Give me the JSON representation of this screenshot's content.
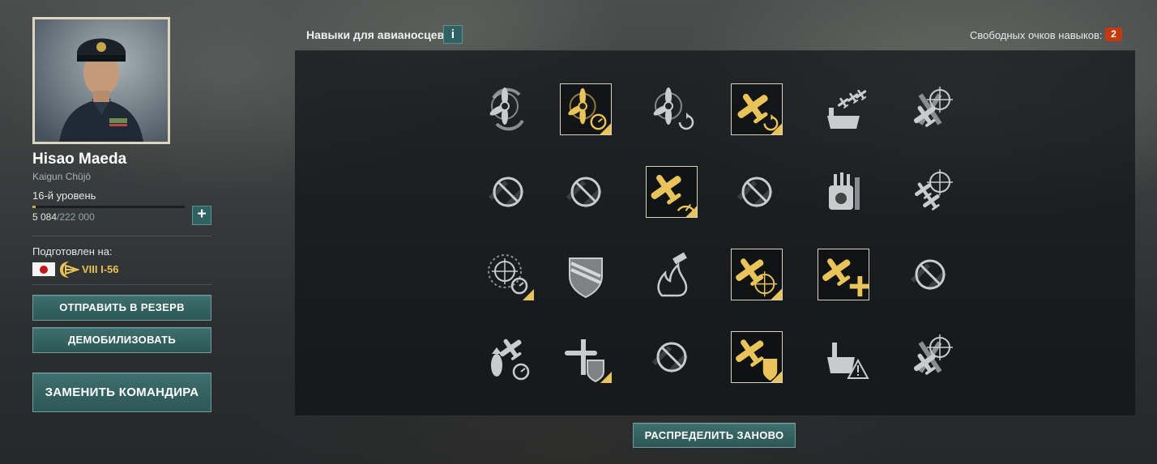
{
  "commander": {
    "name": "Hisao Maeda",
    "rank": "Kaigun Chūjō",
    "level": "16-й уровень",
    "xp_current": "5 084",
    "xp_total": "/222 000",
    "xp_progress": 0.023,
    "xp_plus": "+",
    "trained_for_label": "Подготовлен на:",
    "ship_name": "VIII I-56",
    "nation": "Japan"
  },
  "buttons": {
    "reserve": "ОТПРАВИТЬ В РЕЗЕРВ",
    "demobilize": "ДЕМОБИЛИЗОВАТЬ",
    "replace": "ЗАМЕНИТЬ КОМАНДИРА",
    "redistribute": "РАСПРЕДЕЛИТЬ ЗАНОВО"
  },
  "header": {
    "title": "Навыки для авианосцев",
    "info": "i",
    "free_points_label": "Свободных очков навыков:",
    "free_points": "2"
  },
  "colors": {
    "accent_teal": "#2f6262",
    "learned_gold": "#e8c45a",
    "badge_red": "#c33a12"
  },
  "skills": [
    [
      {
        "icon": "propeller-refresh-icon",
        "state": "available"
      },
      {
        "icon": "propeller-timer-icon",
        "state": "learned"
      },
      {
        "icon": "propeller-reload-icon",
        "state": "available"
      },
      {
        "icon": "plane-reload-icon",
        "state": "learned"
      },
      {
        "icon": "carrier-planes-icon",
        "state": "available"
      },
      {
        "icon": "plane-crosshair-icon",
        "state": "available"
      }
    ],
    [
      {
        "icon": "blocked-icon",
        "state": "locked"
      },
      {
        "icon": "blocked-icon",
        "state": "locked"
      },
      {
        "icon": "plane-speedometer-icon",
        "state": "learned"
      },
      {
        "icon": "blocked-icon",
        "state": "locked"
      },
      {
        "icon": "aa-turret-icon",
        "state": "available"
      },
      {
        "icon": "plane-squadron-crosshair-icon",
        "state": "available"
      }
    ],
    [
      {
        "icon": "crosshair-timer-icon",
        "state": "available"
      },
      {
        "icon": "armor-shield-icon",
        "state": "available"
      },
      {
        "icon": "fire-extinguisher-icon",
        "state": "available"
      },
      {
        "icon": "plane-target-icon",
        "state": "learned"
      },
      {
        "icon": "plane-repair-icon",
        "state": "learned"
      },
      {
        "icon": "blocked-icon",
        "state": "locked"
      }
    ],
    [
      {
        "icon": "bomb-plane-timer-icon",
        "state": "available"
      },
      {
        "icon": "torpedo-armor-icon",
        "state": "available"
      },
      {
        "icon": "blocked-icon",
        "state": "locked"
      },
      {
        "icon": "plane-armor-icon",
        "state": "learned"
      },
      {
        "icon": "carrier-warning-icon",
        "state": "available"
      },
      {
        "icon": "plane-crosshair-icon",
        "state": "available"
      }
    ]
  ]
}
